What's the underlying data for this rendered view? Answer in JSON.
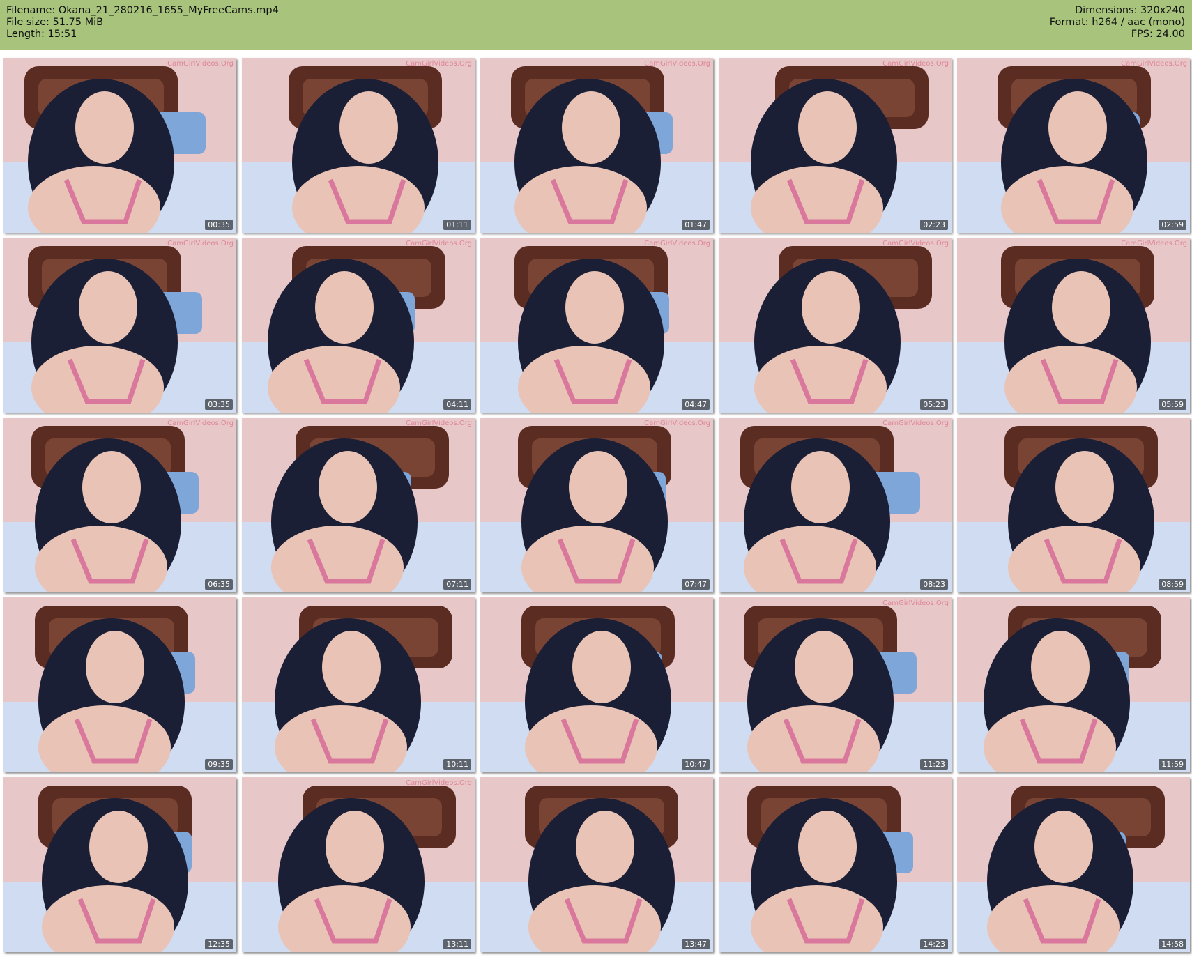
{
  "header": {
    "filename": "Filename: Okana_21_280216_1655_MyFreeCams.mp4",
    "file_size": "File size: 51.75 MiB",
    "length": "Length: 15:51",
    "dimensions": "Dimensions: 320x240",
    "format": "Format: h264 / aac (mono)",
    "fps": "FPS: 24.00"
  },
  "watermark": "CamGirlVideos.Org",
  "colors": {
    "header_bg": "#a8c47c",
    "wall": "#e8c7c9",
    "bed_frame": "#5a2c22",
    "sheet": "#cfdcf2",
    "hair": "#1b1f36",
    "skin": "#e9c4b6",
    "top": "#d9779c"
  },
  "thumbnails": [
    {
      "time": "00:35",
      "watermark": true
    },
    {
      "time": "01:11",
      "watermark": true
    },
    {
      "time": "01:47",
      "watermark": true
    },
    {
      "time": "02:23",
      "watermark": true
    },
    {
      "time": "02:59",
      "watermark": true
    },
    {
      "time": "03:35",
      "watermark": true
    },
    {
      "time": "04:11",
      "watermark": true
    },
    {
      "time": "04:47",
      "watermark": true
    },
    {
      "time": "05:23",
      "watermark": true
    },
    {
      "time": "05:59",
      "watermark": true
    },
    {
      "time": "06:35",
      "watermark": true
    },
    {
      "time": "07:11",
      "watermark": true
    },
    {
      "time": "07:47",
      "watermark": true
    },
    {
      "time": "08:23",
      "watermark": true
    },
    {
      "time": "08:59",
      "watermark": false
    },
    {
      "time": "09:35",
      "watermark": false
    },
    {
      "time": "10:11",
      "watermark": false
    },
    {
      "time": "10:47",
      "watermark": false
    },
    {
      "time": "11:23",
      "watermark": true
    },
    {
      "time": "11:59",
      "watermark": false
    },
    {
      "time": "12:35",
      "watermark": false
    },
    {
      "time": "13:11",
      "watermark": true
    },
    {
      "time": "13:47",
      "watermark": false
    },
    {
      "time": "14:23",
      "watermark": false
    },
    {
      "time": "14:58",
      "watermark": false
    }
  ]
}
